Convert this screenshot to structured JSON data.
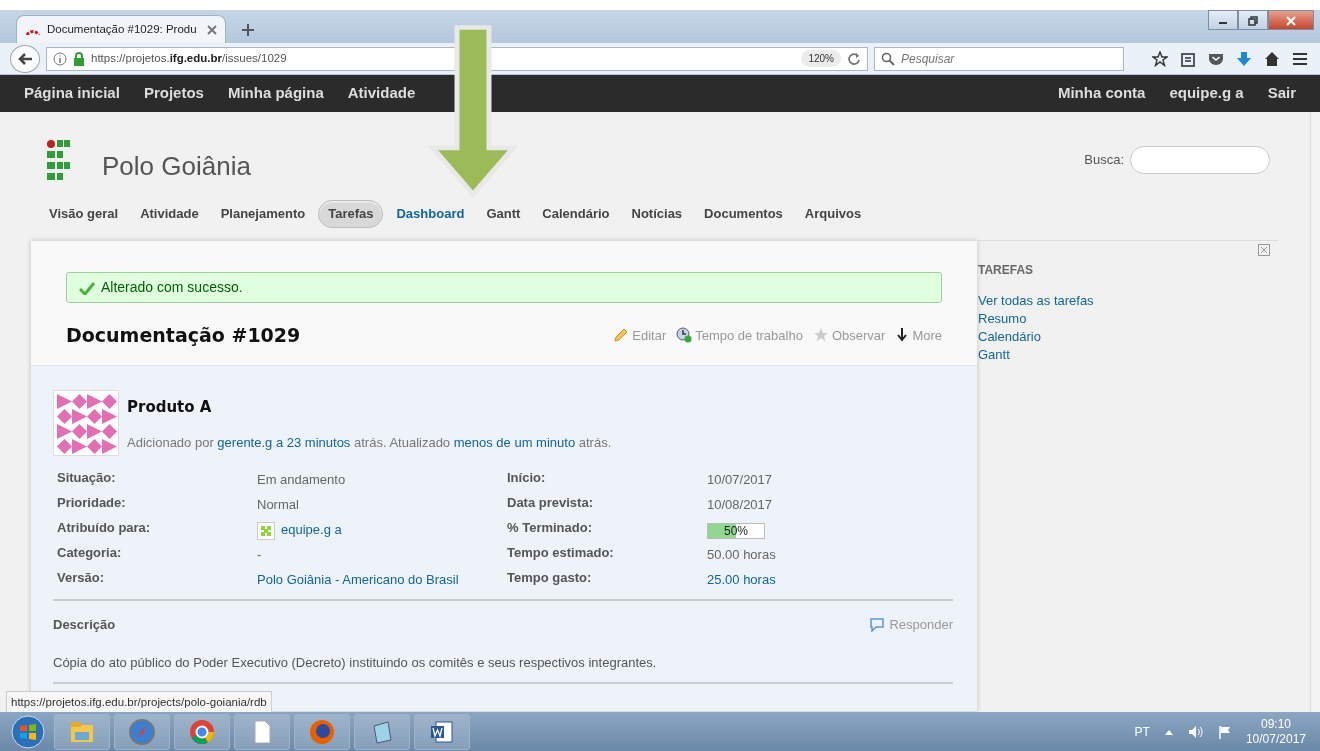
{
  "browser": {
    "tab_title": "Documentação #1029: Produ",
    "url": "https://projetos.**ifg.edu.br**/issues/1029",
    "zoom": "120%",
    "search_placeholder": "Pesquisar"
  },
  "top_menu": {
    "left": [
      "Página inicial",
      "Projetos",
      "Minha página",
      "Atividade"
    ],
    "right": [
      "Minha conta",
      "equipe.g a",
      "Sair"
    ]
  },
  "project": {
    "title": "Polo Goiânia",
    "search_label": "Busca:"
  },
  "tabs": [
    {
      "label": "Visão geral",
      "selected": false
    },
    {
      "label": "Atividade",
      "selected": false
    },
    {
      "label": "Planejamento",
      "selected": false
    },
    {
      "label": "Tarefas",
      "selected": true
    },
    {
      "label": "Dashboard",
      "selected": false,
      "kind": "highlight"
    },
    {
      "label": "Gantt",
      "selected": false
    },
    {
      "label": "Calendário",
      "selected": false
    },
    {
      "label": "Notícias",
      "selected": false
    },
    {
      "label": "Documentos",
      "selected": false
    },
    {
      "label": "Arquivos",
      "selected": false
    }
  ],
  "flash": "Alterado com sucesso.",
  "issue": {
    "title": "Documentação #1029",
    "actions": [
      {
        "kind": "edit",
        "label": "Editar"
      },
      {
        "kind": "time",
        "label": "Tempo de trabalho"
      },
      {
        "kind": "watch",
        "label": "Observar"
      },
      {
        "kind": "more",
        "label": "More"
      }
    ],
    "subject": "Produto A",
    "byline": [
      {
        "kind": "text",
        "text": "Adicionado por"
      },
      {
        "kind": "link",
        "text": "gerente.g a"
      },
      {
        "kind": "link",
        "text": "23 minutos"
      },
      {
        "kind": "text",
        "text": "atrás. Atualizado"
      },
      {
        "kind": "link",
        "text": "menos de um minuto"
      },
      {
        "kind": "text",
        "text": "atrás."
      }
    ],
    "attributes_left": [
      {
        "label": "Situação:",
        "kind": "text",
        "value": "Em andamento"
      },
      {
        "label": "Prioridade:",
        "kind": "text",
        "value": "Normal"
      },
      {
        "label": "Atribuído para:",
        "kind": "user",
        "value": "equipe.g a"
      },
      {
        "label": "Categoria:",
        "kind": "text",
        "value": "-"
      },
      {
        "label": "Versão:",
        "kind": "link",
        "value": "Polo Goiânia - Americano do Brasil"
      }
    ],
    "attributes_right": [
      {
        "label": "Início:",
        "kind": "text",
        "value": "10/07/2017"
      },
      {
        "label": "Data prevista:",
        "kind": "text",
        "value": "10/08/2017"
      },
      {
        "label": "% Terminado:",
        "kind": "progress",
        "value": "50%",
        "level": 0.5
      },
      {
        "label": "Tempo estimado:",
        "kind": "text",
        "value": "50.00 horas"
      },
      {
        "label": "Tempo gasto:",
        "kind": "link",
        "value": "25.00 horas"
      }
    ],
    "description_label": "Descrição",
    "reply": "Responder",
    "description": "Cópia do ato público do Poder Executivo (Decreto) instituindo os comitês e seus respectivos integrantes."
  },
  "sidebar": {
    "title": "TAREFAS",
    "links": [
      "Ver todas as tarefas",
      "Resumo",
      "Calendário",
      "Gantt"
    ]
  },
  "status_url": "https://projetos.ifg.edu.br/projects/polo-goiania/rdb",
  "taskbar": {
    "language": "PT",
    "time": "09:10",
    "date": "10/07/2017"
  }
}
